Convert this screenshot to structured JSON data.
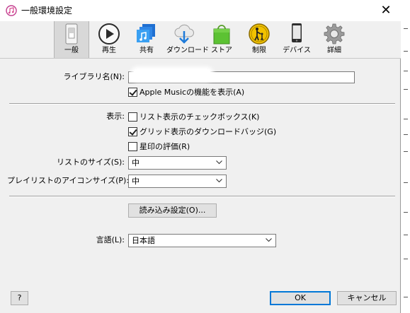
{
  "window": {
    "title": "一般環境設定",
    "close_glyph": "✕"
  },
  "toolbar": {
    "items": [
      {
        "label": "一般",
        "icon": "switch-icon",
        "selected": true
      },
      {
        "label": "再生",
        "icon": "play-icon",
        "selected": false
      },
      {
        "label": "共有",
        "icon": "sharing-icon",
        "selected": false
      },
      {
        "label": "ダウンロード",
        "icon": "download-icon",
        "selected": false
      },
      {
        "label": "ストア",
        "icon": "store-bag-icon",
        "selected": false
      },
      {
        "label": "制限",
        "icon": "parental-icon",
        "selected": false
      },
      {
        "label": "デバイス",
        "icon": "device-icon",
        "selected": false
      },
      {
        "label": "詳細",
        "icon": "gear-icon",
        "selected": false
      }
    ]
  },
  "library": {
    "label": "ライブラリ名(N):",
    "value": ""
  },
  "apple_music": {
    "label": "Apple Musicの機能を表示(A)",
    "checked": true
  },
  "display": {
    "label": "表示:",
    "options": [
      {
        "label": "リスト表示のチェックボックス(K)",
        "checked": false
      },
      {
        "label": "グリッド表示のダウンロードバッジ(G)",
        "checked": true
      },
      {
        "label": "星印の評価(R)",
        "checked": false
      }
    ]
  },
  "list_size": {
    "label": "リストのサイズ(S):",
    "value": "中"
  },
  "playlist_icon_size": {
    "label": "プレイリストのアイコンサイズ(P):",
    "value": "中"
  },
  "import_button": {
    "label": "読み込み設定(O)..."
  },
  "language": {
    "label": "言語(L):",
    "value": "日本語"
  },
  "footer": {
    "help_label": "?",
    "ok_label": "OK",
    "cancel_label": "キャンセル"
  },
  "colors": {
    "accent": "#0078d7",
    "dialog_bg": "#f0f0f0"
  }
}
